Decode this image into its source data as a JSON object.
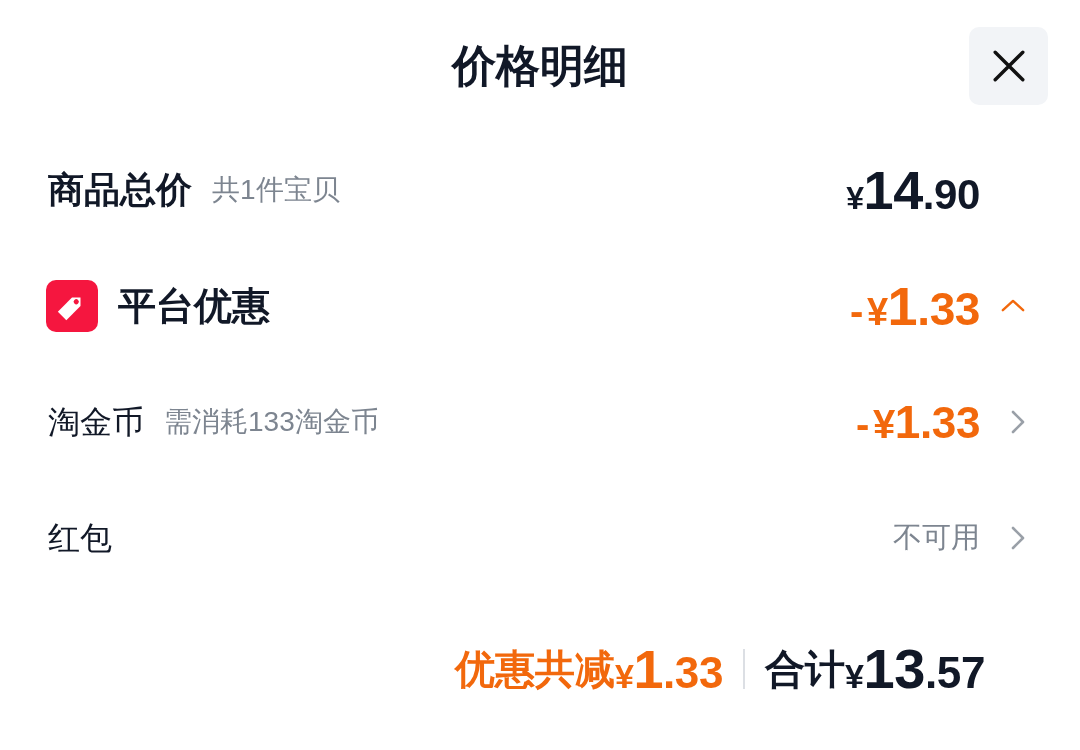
{
  "header": {
    "title": "价格明细"
  },
  "rows": [
    {
      "kind": "total",
      "label": "商品总价",
      "note": "共1件宝贝",
      "amount": {
        "currency": "¥",
        "integer": "14",
        "decimal": ".90"
      }
    },
    {
      "kind": "group",
      "label": "平台优惠",
      "expanded": true,
      "amount": {
        "sign": "-",
        "currency": "¥",
        "integer": "1",
        "decimal": ".33"
      }
    },
    {
      "kind": "item",
      "label": "淘金币",
      "note": "需消耗133淘金币",
      "amount": {
        "sign": "-",
        "currency": "¥",
        "integer": "1",
        "decimal": ".33"
      }
    },
    {
      "kind": "item",
      "label": "红包",
      "status": "不可用"
    }
  ],
  "footer": {
    "discount_label": "优惠共减",
    "discount": {
      "currency": "¥",
      "integer": "1",
      "decimal": ".33"
    },
    "total_label": "合计",
    "total": {
      "currency": "¥",
      "integer": "13",
      "decimal": ".57"
    }
  }
}
